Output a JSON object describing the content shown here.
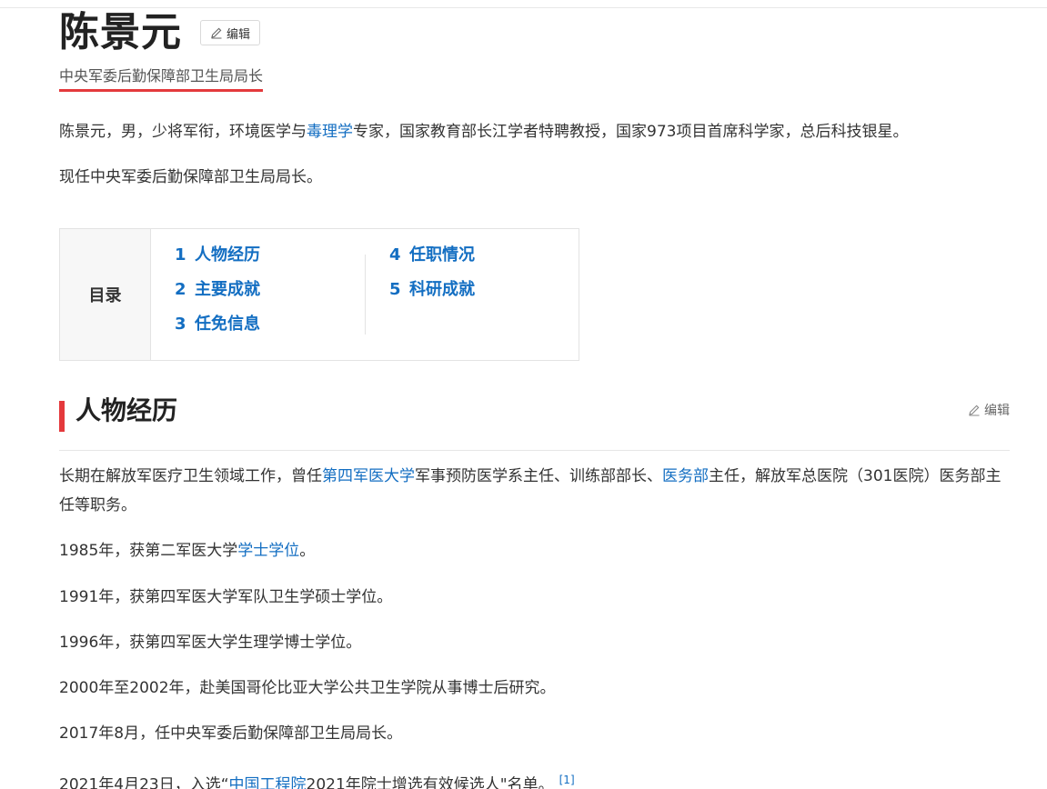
{
  "header": {
    "title": "陈景元",
    "edit_label": "编辑",
    "subtitle": "中央军委后勤保障部卫生局局长"
  },
  "summary": {
    "p1_a": "陈景元，男，少将军衔，环境医学与",
    "p1_link": "毒理学",
    "p1_b": "专家，国家教育部长江学者特聘教授，国家973项目首席科学家，总后科技银星。",
    "p2": "现任中央军委后勤保障部卫生局局长。"
  },
  "toc": {
    "label": "目录",
    "items": [
      {
        "num": "1",
        "label": "人物经历"
      },
      {
        "num": "2",
        "label": "主要成就"
      },
      {
        "num": "3",
        "label": "任免信息"
      },
      {
        "num": "4",
        "label": "任职情况"
      },
      {
        "num": "5",
        "label": "科研成就"
      }
    ]
  },
  "section": {
    "title": "人物经历",
    "edit_label": "编辑",
    "p1_a": "长期在解放军医疗卫生领域工作，曾任",
    "p1_link1": "第四军医大学",
    "p1_b": "军事预防医学系主任、训练部部长、",
    "p1_link2": "医务部",
    "p1_c": "主任，解放军总医院（301医院）医务部主任等职务。",
    "p2_a": "1985年，获第二军医大学",
    "p2_link": "学士学位",
    "p2_b": "。",
    "p3": "1991年，获第四军医大学军队卫生学硕士学位。",
    "p4": "1996年，获第四军医大学生理学博士学位。",
    "p5": "2000年至2002年，赴美国哥伦比亚大学公共卫生学院从事博士后研究。",
    "p6": "2017年8月，任中央军委后勤保障部卫生局局长。",
    "p7_a": "2021年4月23日，入选“",
    "p7_link": "中国工程院",
    "p7_b": "2021年院士增选有效候选人\"名单。",
    "p7_ref": "[1]"
  },
  "colors": {
    "accent_red": "#e4393c",
    "link_blue": "#136ec2"
  }
}
